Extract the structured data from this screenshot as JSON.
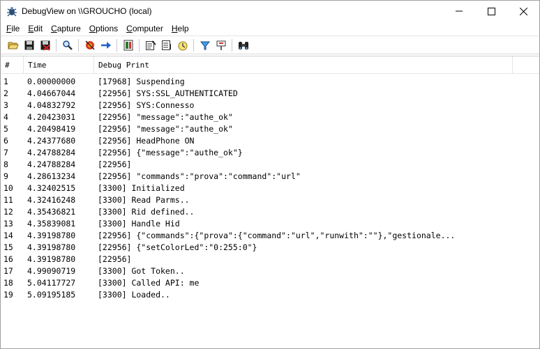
{
  "window": {
    "title": "DebugView on \\\\GROUCHO (local)"
  },
  "menu": [
    "File",
    "Edit",
    "Capture",
    "Options",
    "Computer",
    "Help"
  ],
  "columns": {
    "num": "#",
    "time": "Time",
    "msg": "Debug Print"
  },
  "rows": [
    {
      "n": "1",
      "t": "0.00000000",
      "m": "[17968] Suspending"
    },
    {
      "n": "2",
      "t": "4.04667044",
      "m": "[22956] SYS:SSL_AUTHENTICATED"
    },
    {
      "n": "3",
      "t": "4.04832792",
      "m": "[22956] SYS:Connesso"
    },
    {
      "n": "4",
      "t": "4.20423031",
      "m": "[22956] \"message\":\"authe_ok\""
    },
    {
      "n": "5",
      "t": "4.20498419",
      "m": "[22956] \"message\":\"authe_ok\""
    },
    {
      "n": "6",
      "t": "4.24377680",
      "m": "[22956] HeadPhone ON"
    },
    {
      "n": "7",
      "t": "4.24788284",
      "m": "[22956] {\"message\":\"authe_ok\"}"
    },
    {
      "n": "8",
      "t": "4.24788284",
      "m": "[22956]"
    },
    {
      "n": "9",
      "t": "4.28613234",
      "m": "[22956] \"commands\":\"prova\":\"command\":\"url\""
    },
    {
      "n": "10",
      "t": "4.32402515",
      "m": "[3300] Initialized"
    },
    {
      "n": "11",
      "t": "4.32416248",
      "m": "[3300] Read Parms.."
    },
    {
      "n": "12",
      "t": "4.35436821",
      "m": "[3300] Rid defined.."
    },
    {
      "n": "13",
      "t": "4.35839081",
      "m": "[3300] Handle Hid"
    },
    {
      "n": "14",
      "t": "4.39198780",
      "m": "[22956] {\"commands\":{\"prova\":{\"command\":\"url\",\"runwith\":\"\"},\"gestionale..."
    },
    {
      "n": "15",
      "t": "4.39198780",
      "m": "[22956] {\"setColorLed\":\"0:255:0\"}"
    },
    {
      "n": "16",
      "t": "4.39198780",
      "m": "[22956]"
    },
    {
      "n": "17",
      "t": "4.99090719",
      "m": "[3300] Got Token.."
    },
    {
      "n": "18",
      "t": "5.04117727",
      "m": "[3300] Called API: me"
    },
    {
      "n": "19",
      "t": "5.09195185",
      "m": "[3300] Loaded.."
    }
  ],
  "toolbar_icons": [
    "open-icon",
    "save-icon",
    "clear-icon",
    "find-icon",
    "capture-icon",
    "autoscroll-icon",
    "clear-display-icon",
    "filter-icon",
    "highlight-icon",
    "history-icon",
    "clock-icon",
    "window-icon",
    "bookmark-icon",
    "search-binoculars-icon"
  ]
}
